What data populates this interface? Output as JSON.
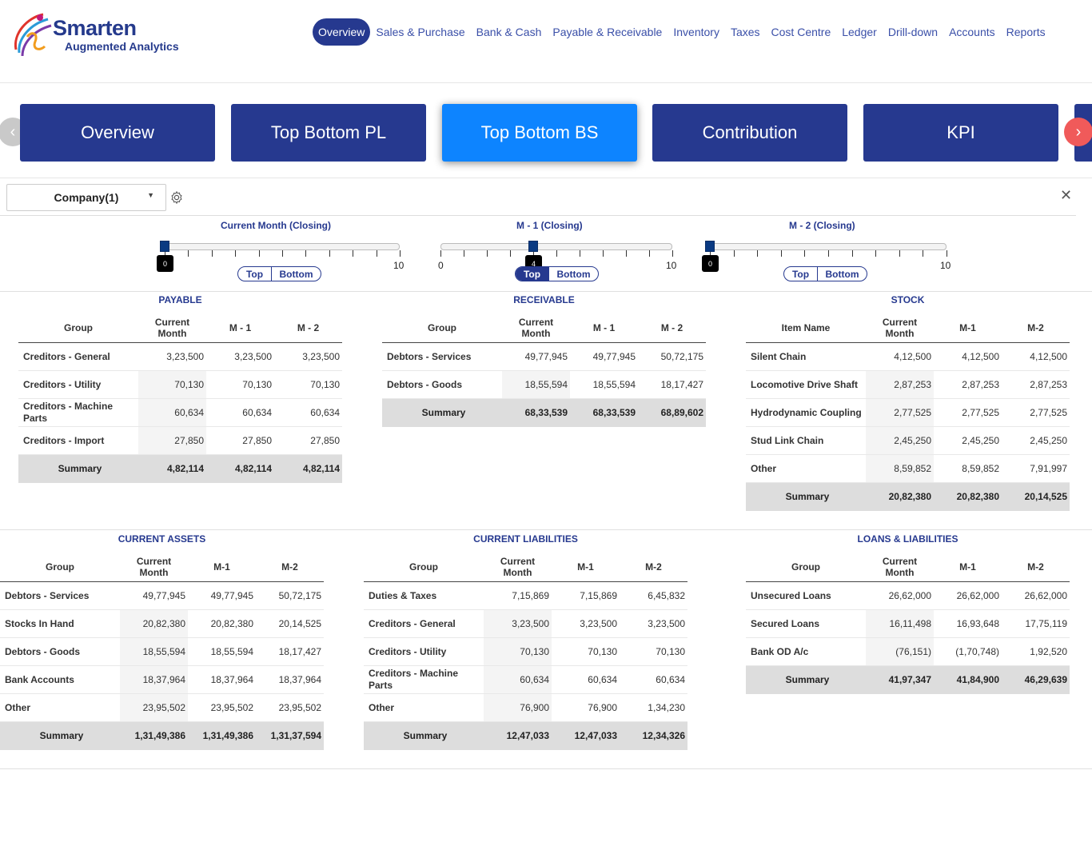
{
  "brand": {
    "name": "Smarten",
    "tagline": "Augmented Analytics"
  },
  "nav": [
    "Overview",
    "Sales & Purchase",
    "Bank & Cash",
    "Payable & Receivable",
    "Inventory",
    "Taxes",
    "Cost Centre",
    "Ledger",
    "Drill-down",
    "Accounts",
    "Reports"
  ],
  "tabs": [
    "Overview",
    "Top Bottom PL",
    "Top Bottom BS",
    "Contribution",
    "KPI"
  ],
  "active_tab": "Top Bottom BS",
  "filter": {
    "company": "Company(1)"
  },
  "sliders": [
    {
      "title": "Current Month (Closing)",
      "value": "0",
      "min": "0",
      "max": "10",
      "top_label": "Top",
      "bottom_label": "Bottom",
      "selected": "none"
    },
    {
      "title": "M - 1 (Closing)",
      "value": "4",
      "min": "0",
      "max": "10",
      "top_label": "Top",
      "bottom_label": "Bottom",
      "selected": "Top"
    },
    {
      "title": "M - 2 (Closing)",
      "value": "0",
      "min": "0",
      "max": "10",
      "top_label": "Top",
      "bottom_label": "Bottom",
      "selected": "none"
    }
  ],
  "tables": {
    "payable": {
      "title": "PAYABLE",
      "headers": [
        "Group",
        "Current Month",
        "M - 1",
        "M - 2"
      ],
      "rows": [
        [
          "Creditors - General",
          "3,23,500",
          "3,23,500",
          "3,23,500"
        ],
        [
          "Creditors - Utility",
          "70,130",
          "70,130",
          "70,130"
        ],
        [
          "Creditors - Machine Parts",
          "60,634",
          "60,634",
          "60,634"
        ],
        [
          "Creditors - Import",
          "27,850",
          "27,850",
          "27,850"
        ]
      ],
      "summary": [
        "Summary",
        "4,82,114",
        "4,82,114",
        "4,82,114"
      ]
    },
    "receivable": {
      "title": "RECEIVABLE",
      "headers": [
        "Group",
        "Current Month",
        "M - 1",
        "M - 2"
      ],
      "rows": [
        [
          "Debtors - Services",
          "49,77,945",
          "49,77,945",
          "50,72,175"
        ],
        [
          "Debtors - Goods",
          "18,55,594",
          "18,55,594",
          "18,17,427"
        ]
      ],
      "summary": [
        "Summary",
        "68,33,539",
        "68,33,539",
        "68,89,602"
      ]
    },
    "stock": {
      "title": "STOCK",
      "headers": [
        "Item Name",
        "Current Month",
        "M-1",
        "M-2"
      ],
      "rows": [
        [
          "Silent Chain",
          "4,12,500",
          "4,12,500",
          "4,12,500"
        ],
        [
          "Locomotive Drive Shaft",
          "2,87,253",
          "2,87,253",
          "2,87,253"
        ],
        [
          "Hydrodynamic Coupling",
          "2,77,525",
          "2,77,525",
          "2,77,525"
        ],
        [
          "Stud Link Chain",
          "2,45,250",
          "2,45,250",
          "2,45,250"
        ],
        [
          "Other",
          "8,59,852",
          "8,59,852",
          "7,91,997"
        ]
      ],
      "summary": [
        "Summary",
        "20,82,380",
        "20,82,380",
        "20,14,525"
      ]
    },
    "current_assets": {
      "title": "CURRENT ASSETS",
      "headers": [
        "Group",
        "Current Month",
        "M-1",
        "M-2"
      ],
      "rows": [
        [
          "Debtors - Services",
          "49,77,945",
          "49,77,945",
          "50,72,175"
        ],
        [
          "Stocks In Hand",
          "20,82,380",
          "20,82,380",
          "20,14,525"
        ],
        [
          "Debtors - Goods",
          "18,55,594",
          "18,55,594",
          "18,17,427"
        ],
        [
          "Bank Accounts",
          "18,37,964",
          "18,37,964",
          "18,37,964"
        ],
        [
          "Other",
          "23,95,502",
          "23,95,502",
          "23,95,502"
        ]
      ],
      "summary": [
        "Summary",
        "1,31,49,386",
        "1,31,49,386",
        "1,31,37,594"
      ]
    },
    "current_liabilities": {
      "title": "CURRENT LIABILITIES",
      "headers": [
        "Group",
        "Current Month",
        "M-1",
        "M-2"
      ],
      "rows": [
        [
          "Duties & Taxes",
          "7,15,869",
          "7,15,869",
          "6,45,832"
        ],
        [
          "Creditors - General",
          "3,23,500",
          "3,23,500",
          "3,23,500"
        ],
        [
          "Creditors - Utility",
          "70,130",
          "70,130",
          "70,130"
        ],
        [
          "Creditors - Machine Parts",
          "60,634",
          "60,634",
          "60,634"
        ],
        [
          "Other",
          "76,900",
          "76,900",
          "1,34,230"
        ]
      ],
      "summary": [
        "Summary",
        "12,47,033",
        "12,47,033",
        "12,34,326"
      ]
    },
    "loans": {
      "title": "LOANS & LIABILITIES",
      "headers": [
        "Group",
        "Current Month",
        "M-1",
        "M-2"
      ],
      "rows": [
        [
          "Unsecured Loans",
          "26,62,000",
          "26,62,000",
          "26,62,000"
        ],
        [
          "Secured Loans",
          "16,11,498",
          "16,93,648",
          "17,75,119"
        ],
        [
          "Bank OD A/c",
          "(76,151)",
          "(1,70,748)",
          "1,92,520"
        ]
      ],
      "summary": [
        "Summary",
        "41,97,347",
        "41,84,900",
        "46,29,639"
      ]
    }
  }
}
